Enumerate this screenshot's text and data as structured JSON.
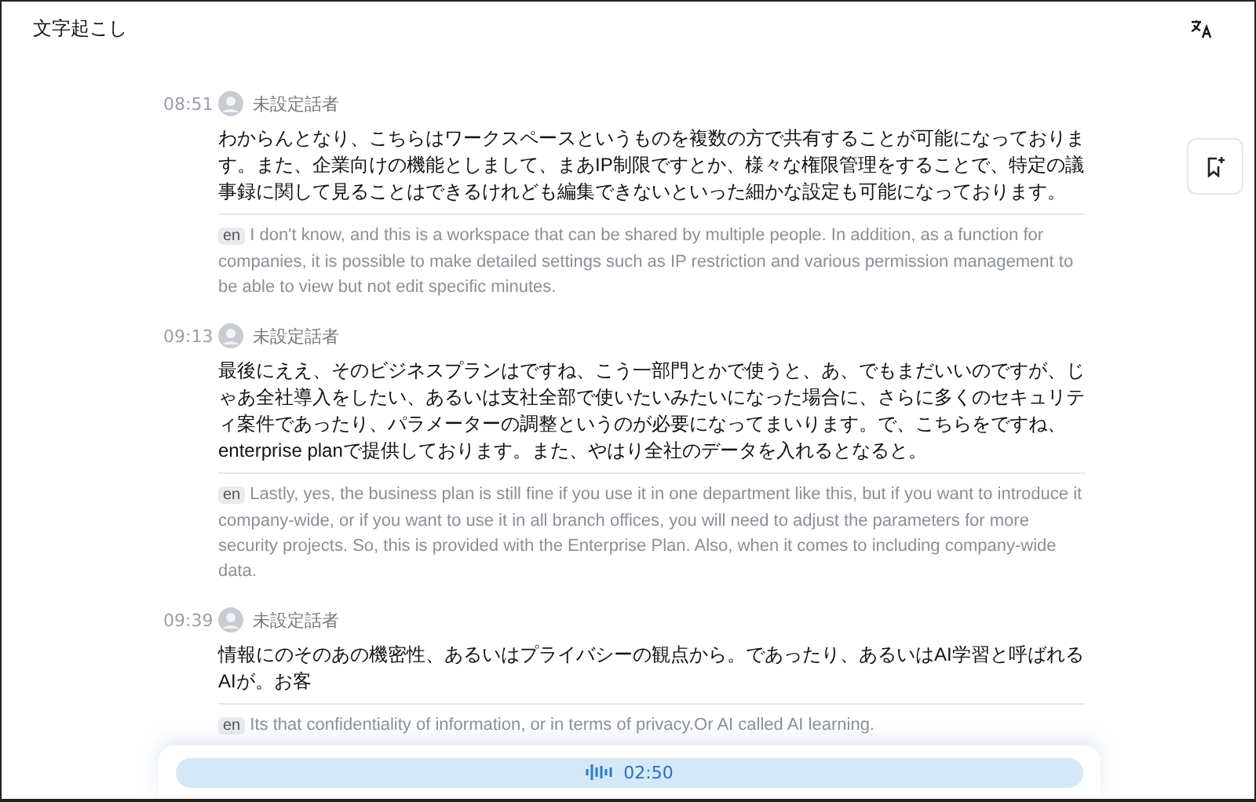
{
  "window": {
    "title": "文字起こし"
  },
  "entries": [
    {
      "time": "08:51",
      "speaker": "未設定話者",
      "text": "わからんとなり、こちらはワークスペースというものを複数の方で共有することが可能になっております。また、企業向けの機能としまして、まあIP制限ですとか、様々な権限管理をすることで、特定の議事録に関して見ることはできるけれども編集できないといった細かな設定も可能になっております。",
      "lang": "en",
      "translation": "I don't know, and this is a workspace that can be shared by multiple people. In addition, as a function for companies, it is possible to make detailed settings such as IP restriction and various permission management to be able to view but not edit specific minutes."
    },
    {
      "time": "09:13",
      "speaker": "未設定話者",
      "text": "最後にええ、そのビジネスプランはですね、こう一部門とかで使うと、あ、でもまだいいのですが、じゃあ全社導入をしたい、あるいは支社全部で使いたいみたいになった場合に、さらに多くのセキュリティ案件であったり、パラメーターの調整というのが必要になってまいります。で、こちらをですね、enterprise planで提供しております。また、やはり全社のデータを入れるとなると。",
      "lang": "en",
      "translation": "Lastly, yes, the business plan is still fine if you use it in one department like this, but if you want to introduce it company-wide, or if you want to use it in all branch offices, you will need to adjust the parameters for more security projects. So, this is provided with the Enterprise Plan. Also, when it comes to including company-wide data."
    },
    {
      "time": "09:39",
      "speaker": "未設定話者",
      "text": "情報にのそのあの機密性、あるいはプライバシーの観点から。であったり、あるいはAI学習と呼ばれるAIが。お客",
      "lang": "en",
      "translation": "Its that confidentiality of information, or in terms of privacy.Or AI called AI learning."
    }
  ],
  "player": {
    "elapsed": "02:50"
  }
}
